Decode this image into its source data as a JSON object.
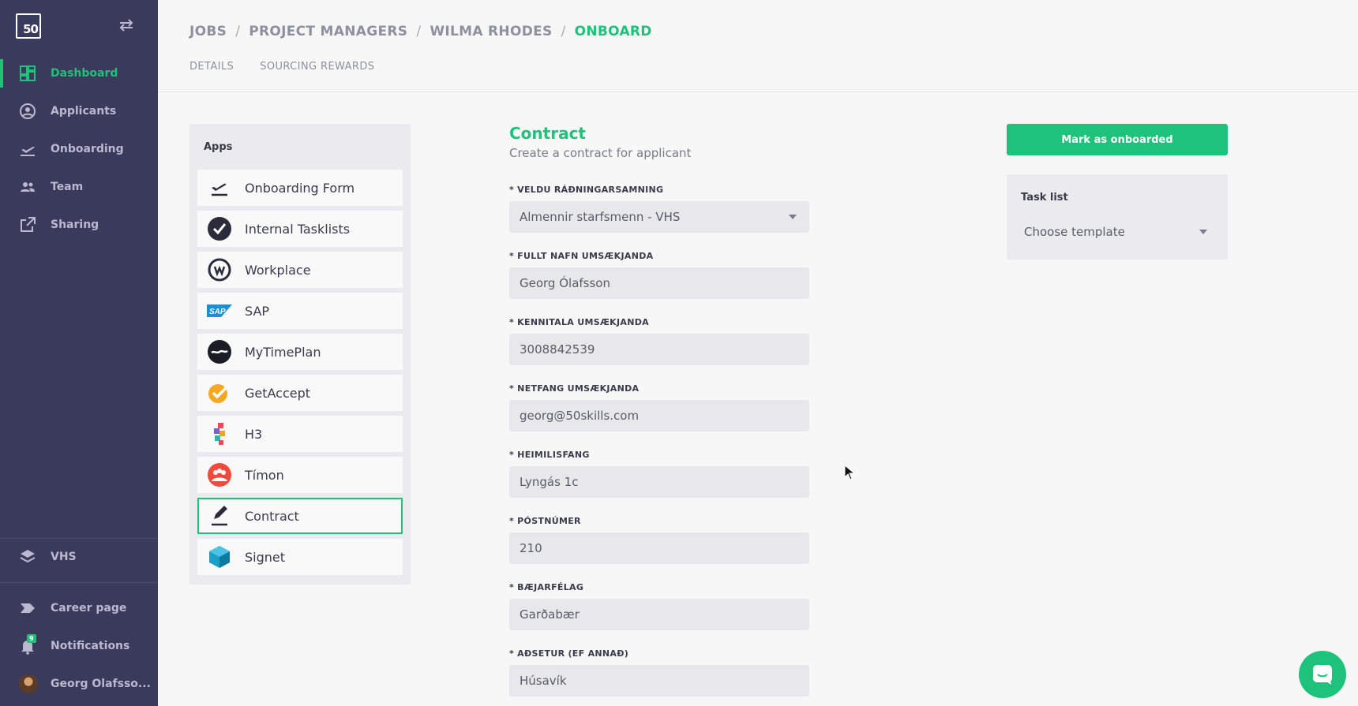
{
  "sidebar": {
    "logo": "50",
    "nav": [
      {
        "label": "Dashboard",
        "icon": "dashboard-icon",
        "active": true
      },
      {
        "label": "Applicants",
        "icon": "person-circle-icon"
      },
      {
        "label": "Onboarding",
        "icon": "plane-icon"
      },
      {
        "label": "Team",
        "icon": "team-icon"
      },
      {
        "label": "Sharing",
        "icon": "share-icon"
      }
    ],
    "workspace": {
      "label": "VHS",
      "icon": "layers-icon"
    },
    "bottom": [
      {
        "label": "Career page",
        "icon": "tag-icon"
      },
      {
        "label": "Notifications",
        "icon": "bell-icon",
        "badge": "9"
      },
      {
        "label": "Georg Olafsso...",
        "icon": "avatar"
      }
    ]
  },
  "header": {
    "breadcrumb": [
      "JOBS",
      "PROJECT MANAGERS",
      "WILMA RHODES",
      "ONBOARD"
    ],
    "tabs": [
      "DETAILS",
      "SOURCING REWARDS"
    ]
  },
  "apps": {
    "title": "Apps",
    "items": [
      {
        "label": "Onboarding Form",
        "icon": "plane-takeoff-icon"
      },
      {
        "label": "Internal Tasklists",
        "icon": "checkmark-circle-icon"
      },
      {
        "label": "Workplace",
        "icon": "workplace-icon"
      },
      {
        "label": "SAP",
        "icon": "sap-icon"
      },
      {
        "label": "MyTimePlan",
        "icon": "mytimeplan-icon"
      },
      {
        "label": "GetAccept",
        "icon": "getaccept-icon"
      },
      {
        "label": "H3",
        "icon": "h3-icon"
      },
      {
        "label": "Tímon",
        "icon": "timon-icon"
      },
      {
        "label": "Contract",
        "icon": "pen-icon",
        "selected": true
      },
      {
        "label": "Signet",
        "icon": "signet-cube-icon"
      }
    ]
  },
  "form": {
    "title": "Contract",
    "subtitle": "Create a contract for applicant",
    "fields": [
      {
        "label": "* VELDU RÁÐNINGARSAMNING",
        "value": "Almennir starfsmenn - VHS",
        "type": "select"
      },
      {
        "label": "* FULLT NAFN UMSÆKJANDA",
        "value": "Georg Ólafsson"
      },
      {
        "label": "* KENNITALA UMSÆKJANDA",
        "value": "3008842539"
      },
      {
        "label": "* NETFANG UMSÆKJANDA",
        "value": "georg@50skills.com"
      },
      {
        "label": "* HEIMILISFANG",
        "value": "Lyngás 1c"
      },
      {
        "label": "* PÓSTNÚMER",
        "value": "210"
      },
      {
        "label": "* BÆJARFÉLAG",
        "value": "Garðabær"
      },
      {
        "label": "* AÐSETUR (EF ANNAÐ)",
        "value": "Húsavík"
      }
    ]
  },
  "actions": {
    "mark_onboarded": "Mark as onboarded"
  },
  "tasklist": {
    "title": "Task list",
    "placeholder": "Choose template"
  },
  "colors": {
    "accent": "#1ec27a",
    "sidebar_bg": "#393a5c",
    "page_bg": "#f7f7f7"
  }
}
